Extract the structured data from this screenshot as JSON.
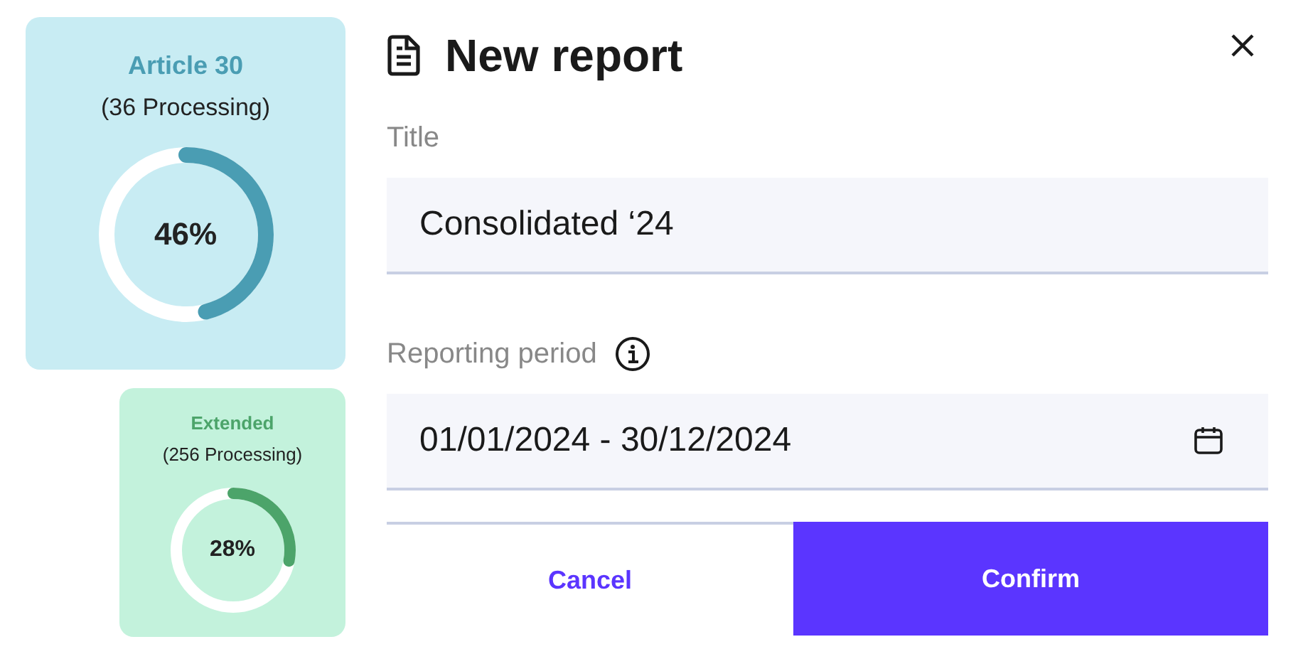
{
  "cards": [
    {
      "kind": "large",
      "title": "Article 30",
      "subtitle": "(36 Processing)",
      "percent": "46%",
      "color": "#4a9db3"
    },
    {
      "kind": "small",
      "title": "Extended",
      "subtitle": "(256 Processing)",
      "percent": "28%",
      "color": "#4ca46a"
    }
  ],
  "dialog": {
    "title": "New report",
    "fields": [
      {
        "kind": "text",
        "label": "Title",
        "value": "Consolidated ‘24"
      },
      {
        "kind": "date",
        "label": "Reporting period",
        "value": "01/01/2024 - 30/12/2024"
      }
    ],
    "buttons": [
      "Cancel",
      "Confirm"
    ]
  }
}
